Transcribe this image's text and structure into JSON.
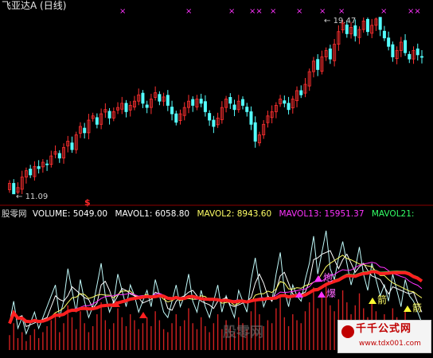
{
  "window": {
    "title": "飞亚达A (日线)"
  },
  "price_panel": {
    "high_label": "19.47",
    "low_label": "11.09",
    "signal_glyph": "$",
    "marker_color": "#ff33ff",
    "up_color": "#ff3030",
    "down_color": "#54ffff"
  },
  "volume_panel": {
    "indicator_name": "股零网",
    "volume_label": "VOLUME: 5049.00",
    "mavol1_label": "MAVOL1: 6058.80",
    "mavol2_label": "MAVOL2: 8943.60",
    "mavol13_label": "MAVOL13: 15951.37",
    "mavol21_label": "MAVOL21:",
    "colors": {
      "name": "#d8d8d8",
      "volume": "#ffffff",
      "mavol1": "#ffffff",
      "mavol2": "#ffff66",
      "mavol13": "#ff33ff",
      "mavol21": "#33ff66"
    },
    "signal_labels": {
      "cannon": "炮",
      "arrow": "箭",
      "explode": "爆"
    }
  },
  "watermark": {
    "site_text": "股零网",
    "brand_title": "千千公式网",
    "brand_url": "www.tdx001.com"
  },
  "chart_data": {
    "type": "candlestick",
    "price_high": 19.47,
    "price_low": 11.09,
    "close_series": [
      11.6,
      11.1,
      11.4,
      11.9,
      12.2,
      12.0,
      12.4,
      12.3,
      12.6,
      12.5,
      12.9,
      13.1,
      12.8,
      13.3,
      13.6,
      13.2,
      13.9,
      14.3,
      14.0,
      14.6,
      14.8,
      14.4,
      14.9,
      15.1,
      14.7,
      15.0,
      15.2,
      15.4,
      15.0,
      15.3,
      15.5,
      15.8,
      15.4,
      15.2,
      15.6,
      15.9,
      15.5,
      15.7,
      15.3,
      14.9,
      14.5,
      14.9,
      15.2,
      15.5,
      15.3,
      15.6,
      15.4,
      15.0,
      14.6,
      14.3,
      14.7,
      15.2,
      15.6,
      15.4,
      15.1,
      15.5,
      15.3,
      15.0,
      14.4,
      13.6,
      13.9,
      14.4,
      14.8,
      15.0,
      15.3,
      15.6,
      15.4,
      15.1,
      15.6,
      16.0,
      15.8,
      16.3,
      16.9,
      17.4,
      17.0,
      17.6,
      17.9,
      17.5,
      18.2,
      18.8,
      19.2,
      18.7,
      19.0,
      18.6,
      18.9,
      19.3,
      18.8,
      19.1,
      19.4,
      18.9,
      18.5,
      18.1,
      17.6,
      17.9,
      18.3,
      17.8,
      17.5,
      17.9,
      17.7,
      17.6
    ],
    "volume_series": [
      5,
      9,
      4,
      6,
      3,
      5,
      7,
      4,
      6,
      8,
      10,
      12,
      6,
      9,
      15,
      11,
      7,
      13,
      9,
      6,
      8,
      12,
      16,
      10,
      7,
      9,
      14,
      11,
      8,
      12,
      10,
      7,
      9,
      11,
      8,
      13,
      10,
      7,
      6,
      9,
      12,
      8,
      10,
      14,
      9,
      7,
      11,
      8,
      6,
      9,
      12,
      7,
      10,
      8,
      6,
      11,
      9,
      7,
      13,
      17,
      12,
      8,
      10,
      9,
      14,
      18,
      11,
      8,
      12,
      10,
      9,
      13,
      16,
      21,
      14,
      18,
      22,
      15,
      13,
      17,
      20,
      16,
      12,
      15,
      19,
      14,
      11,
      16,
      13,
      10,
      12,
      9,
      14,
      11,
      8,
      13,
      10,
      9,
      7,
      5
    ]
  }
}
